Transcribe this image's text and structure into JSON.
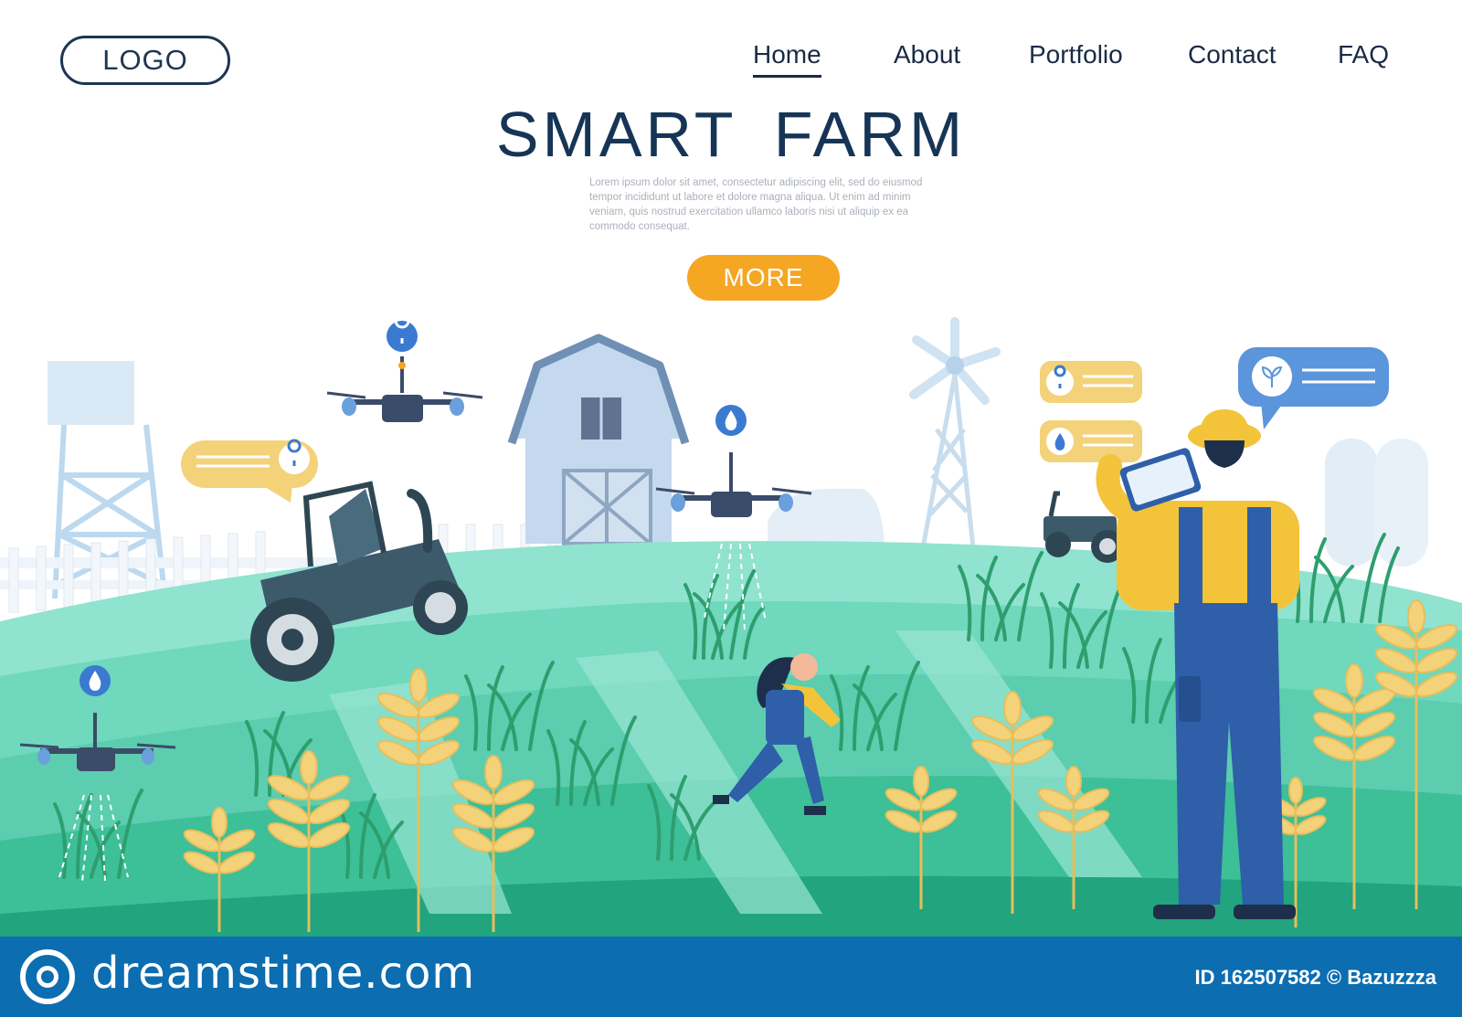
{
  "header": {
    "logo": "LOGO",
    "nav": [
      {
        "label": "Home",
        "active": true
      },
      {
        "label": "About",
        "active": false
      },
      {
        "label": "Portfolio",
        "active": false
      },
      {
        "label": "Contact",
        "active": false
      },
      {
        "label": "FAQ",
        "active": false
      }
    ]
  },
  "hero": {
    "title": "SMART  FARM",
    "body": "Lorem ipsum dolor sit amet, consectetur adipiscing elit, sed do eiusmod tempor incididunt ut labore et dolore magna aliqua. Ut enim ad minim veniam, quis nostrud exercitation ullamco laboris nisi ut aliquip ex ea commodo consequat.",
    "button": "MORE"
  },
  "watermark": {
    "site": "dreamstime.com",
    "id_text": "ID 162507582 © Bazuzzza"
  },
  "colors": {
    "accent": "#f5a623",
    "navy": "#163556",
    "field": "#4fcfb0",
    "field_dark": "#2fb08e",
    "watermark_bar": "#0c6db1",
    "wheat": "#f3d27a"
  }
}
